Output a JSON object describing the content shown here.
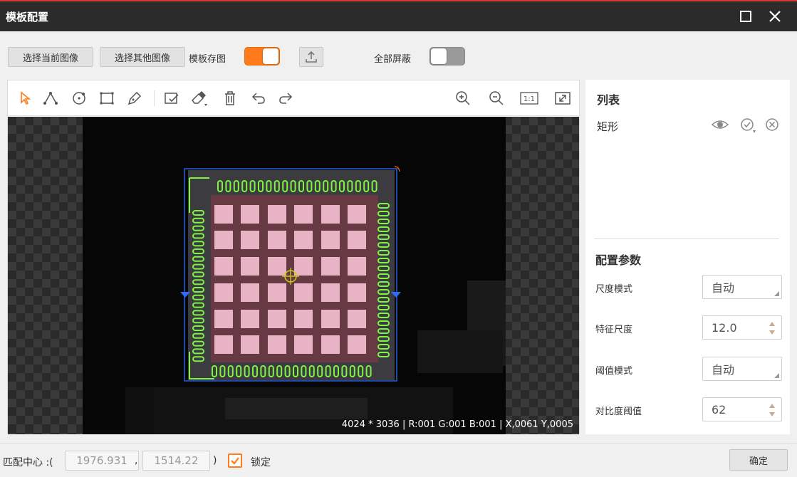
{
  "window": {
    "title": "模板配置",
    "maximize_icon": "maximize-icon",
    "close_icon": "close-icon"
  },
  "toolbar": {
    "select_current_label": "选择当前图像",
    "select_other_label": "选择其他图像",
    "save_template_label": "模板存图",
    "save_template_on": true,
    "upload_icon": "upload-icon",
    "mask_all_label": "全部屏蔽",
    "mask_all_on": false
  },
  "canvas_tools": [
    "select-arrow-icon",
    "polygon-icon",
    "circle-icon",
    "rectangle-icon",
    "pen-icon",
    "mask-edit-icon",
    "eraser-icon",
    "trash-icon",
    "undo-icon",
    "redo-icon",
    "zoom-in-icon",
    "zoom-out-icon",
    "actual-size-icon",
    "fit-window-icon"
  ],
  "canvas": {
    "status": "4024 * 3036  |  R:001  G:001  B:001  |  X,0061  Y,0005"
  },
  "list_panel": {
    "title": "列表",
    "items": [
      {
        "label": "矩形"
      }
    ]
  },
  "config_params": {
    "title": "配置参数",
    "scale_mode_label": "尺度模式",
    "scale_mode_value": "自动",
    "feature_scale_label": "特征尺度",
    "feature_scale_value": "12.0",
    "threshold_mode_label": "阈值模式",
    "threshold_mode_value": "自动",
    "contrast_threshold_label": "对比度阈值",
    "contrast_threshold_value": "62"
  },
  "bottom": {
    "match_center_label": "匹配中心 :(",
    "center_x": "1976.931",
    "comma": ",",
    "center_y": "1514.22",
    "close_paren": ")",
    "lock_label": "锁定",
    "lock_checked": true,
    "confirm_label": "确定"
  },
  "colors": {
    "accent": "#ff7a1a",
    "title_bar": "#2b2b2b",
    "contour_green": "#7ef542",
    "roi_blue": "#2d6bff",
    "pad_pink": "#e8b3c4"
  }
}
